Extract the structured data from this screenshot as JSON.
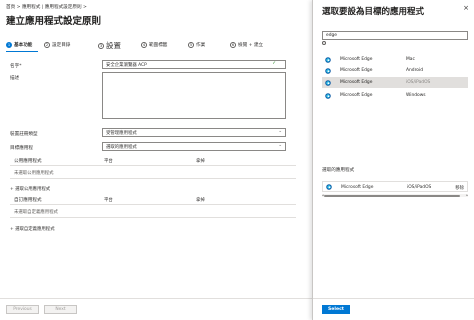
{
  "breadcrumb": "首頁 &gt;  應用程式 | 應用程式設定原則 &gt;",
  "title": "建立應用程式設定原則",
  "steps": [
    {
      "num": "1",
      "label": "基本功能"
    },
    {
      "num": "2",
      "label": "設定目錄"
    },
    {
      "num": "3",
      "label": "設置"
    },
    {
      "num": "4",
      "label": "範圍標籤"
    },
    {
      "num": "5",
      "label": "作業"
    },
    {
      "num": "6",
      "label": "檢閱 + 建立"
    }
  ],
  "form": {
    "name_label": "名字*",
    "name_value": "安全企業瀏覽器 ACP",
    "desc_label": "描述",
    "device_type_label": "裝置註冊類型",
    "device_type_value": "受管理應用程式",
    "target_label": "目標應用程",
    "target_value": "選取的應用程式"
  },
  "public_apps": {
    "header": "公用應用程式",
    "col_platform": "平台",
    "col_remove": "拿掉",
    "empty": "未選取公用應用程式",
    "link": "+ 選取公用應用程式"
  },
  "custom_apps": {
    "header": "自訂應用程式",
    "col_platform": "平台",
    "col_remove": "拿掉",
    "empty": "未選取自定義應用程式",
    "link": "+ 選取自定義應用程式"
  },
  "footer": {
    "previous": "Previous",
    "next": "Next"
  },
  "panel": {
    "title": "選取要設為目標的應用程式",
    "close": "×",
    "search_value": "edge",
    "apps": [
      {
        "name": "Microsoft Edge",
        "platform": "Mac",
        "selected": false
      },
      {
        "name": "Microsoft Edge",
        "platform": "Android",
        "selected": false
      },
      {
        "name": "Microsoft Edge",
        "platform": "iOS/iPadOS",
        "selected": true
      },
      {
        "name": "Microsoft Edge",
        "platform": "Windows",
        "selected": false
      }
    ],
    "selected_label": "選取的應用程式",
    "selected_app": {
      "name": "Microsoft Edge",
      "platform": "iOS/iPadOS",
      "remove": "移除"
    },
    "scroll_left": "◂",
    "scroll_right": "▸",
    "select_button": "Select"
  },
  "colors": {
    "accent": "#0078d4",
    "check": "#107c10"
  },
  "icons": {
    "app": "edge-icon",
    "chevron": "chevron-down-icon",
    "check": "check-icon",
    "close": "close-icon"
  }
}
